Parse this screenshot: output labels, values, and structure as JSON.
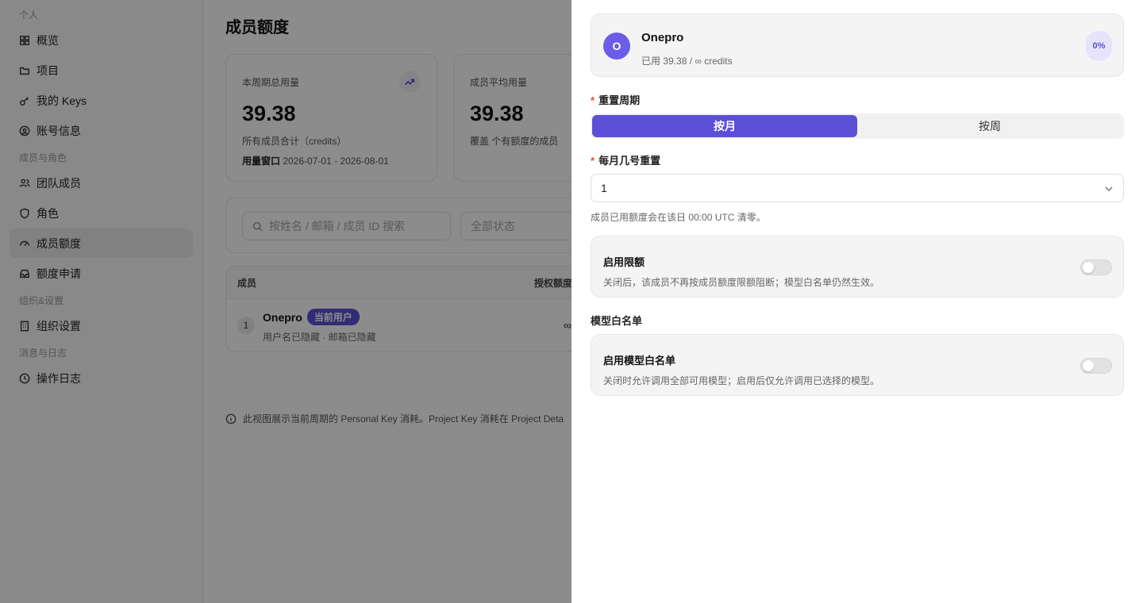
{
  "sidebar": {
    "sections": [
      {
        "label": "个人",
        "items": [
          {
            "label": "概览",
            "icon": "grid-icon"
          },
          {
            "label": "项目",
            "icon": "folder-icon"
          },
          {
            "label": "我的 Keys",
            "icon": "key-icon"
          },
          {
            "label": "账号信息",
            "icon": "user-circle-icon"
          }
        ]
      },
      {
        "label": "成员与角色",
        "items": [
          {
            "label": "团队成员",
            "icon": "users-icon"
          },
          {
            "label": "角色",
            "icon": "shield-icon"
          },
          {
            "label": "成员额度",
            "icon": "gauge-icon",
            "active": true
          },
          {
            "label": "额度申请",
            "icon": "inbox-icon"
          }
        ]
      },
      {
        "label": "组织&设置",
        "items": [
          {
            "label": "组织设置",
            "icon": "building-icon"
          }
        ]
      },
      {
        "label": "消息与日志",
        "items": [
          {
            "label": "操作日志",
            "icon": "log-icon"
          }
        ]
      }
    ]
  },
  "main": {
    "title": "成员额度",
    "stats": [
      {
        "label": "本周期总用量",
        "value": "39.38",
        "sub": "所有成员合计（credits）",
        "window_label": "用量窗口",
        "window_value": "2026-07-01 - 2026-08-01"
      },
      {
        "label": "成员平均用量",
        "value": "39.38",
        "sub": "覆盖 个有额度的成员"
      }
    ],
    "search_placeholder": "按姓名 / 邮箱 / 成员 ID 搜索",
    "status_placeholder": "全部状态",
    "table": {
      "headers": [
        "成员",
        "授权额度"
      ],
      "rows": [
        {
          "index": "1",
          "name": "Onepro",
          "badge": "当前用户",
          "sub": "用户名已隐藏 · 邮箱已隐藏",
          "quota": "∞"
        }
      ]
    },
    "note": "此视图展示当前周期的 Personal Key 消耗。Project Key 消耗在 Project Deta"
  },
  "drawer": {
    "user": {
      "initial": "O",
      "name": "Onepro",
      "used": "已用 39.38 / ∞ credits",
      "percent": "0%"
    },
    "reset_cycle": {
      "label": "重置周期",
      "required_mark": "*",
      "options": [
        "按月",
        "按周"
      ],
      "selected": "按月"
    },
    "reset_day": {
      "label": "每月几号重置",
      "required_mark": "*",
      "value": "1",
      "help": "成员已用额度会在该日 00:00 UTC 清零。"
    },
    "limit": {
      "title": "启用限额",
      "desc": "关闭后，该成员不再按成员额度限额阻断；模型白名单仍然生效。",
      "enabled": false
    },
    "whitelist_section": "模型白名单",
    "whitelist": {
      "title": "启用模型白名单",
      "desc": "关闭时允许调用全部可用模型；启用后仅允许调用已选择的模型。",
      "enabled": false
    }
  },
  "colors": {
    "accent": "#5b4fd6",
    "required": "#e5484d",
    "overlay": "rgba(0,0,0,0.45)"
  }
}
